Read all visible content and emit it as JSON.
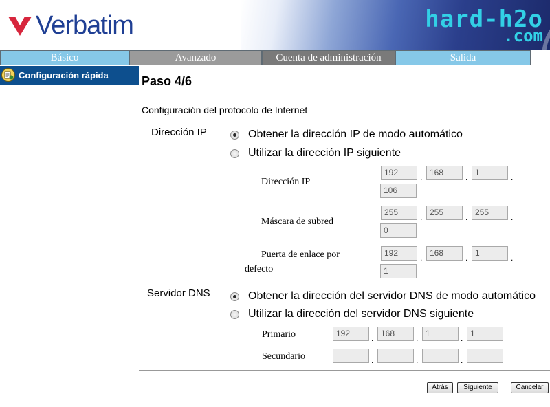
{
  "header": {
    "brand": "Verbatim",
    "watermark_line1": "hard-h2o",
    "watermark_line2": ".com"
  },
  "nav": {
    "tabs": [
      "Básico",
      "Avanzado",
      "Cuenta de administración",
      "Salida"
    ]
  },
  "sidebar": {
    "item_label": "Configuración rápida",
    "item_icon": "wizard-icon"
  },
  "page": {
    "step": "Paso 4/6",
    "section": "Configuración del protocolo de Internet"
  },
  "ip_section": {
    "label": "Dirección IP",
    "option_auto": "Obtener la dirección IP de modo automático",
    "option_manual": "Utilizar la dirección IP siguiente",
    "selected": "auto",
    "ip_label": "Dirección IP",
    "ip": [
      "192",
      "168",
      "1",
      "106"
    ],
    "mask_label": "Máscara de subred",
    "mask": [
      "255",
      "255",
      "255",
      "0"
    ],
    "gateway_label_1": "Puerta de enlace por",
    "gateway_label_2": "defecto",
    "gateway": [
      "192",
      "168",
      "1",
      "1"
    ]
  },
  "dns_section": {
    "label": "Servidor DNS",
    "option_auto": "Obtener la dirección del servidor DNS de modo automático",
    "option_manual": "Utilizar la dirección del servidor DNS siguiente",
    "selected": "auto",
    "primary_label": "Primario",
    "primary": [
      "192",
      "168",
      "1",
      "1"
    ],
    "secondary_label": "Secundario",
    "secondary": [
      "",
      "",
      "",
      ""
    ]
  },
  "buttons": {
    "back": "Atrás",
    "next": "Siguiente",
    "cancel": "Cancelar"
  },
  "colors": {
    "nav_blue": "#86c8e8",
    "nav_gray": "#9b9b9b",
    "sidebar_active": "#0d4f8e",
    "brand_blue": "#1f3f94",
    "brand_red": "#d7263d",
    "watermark": "#32d0e6"
  }
}
